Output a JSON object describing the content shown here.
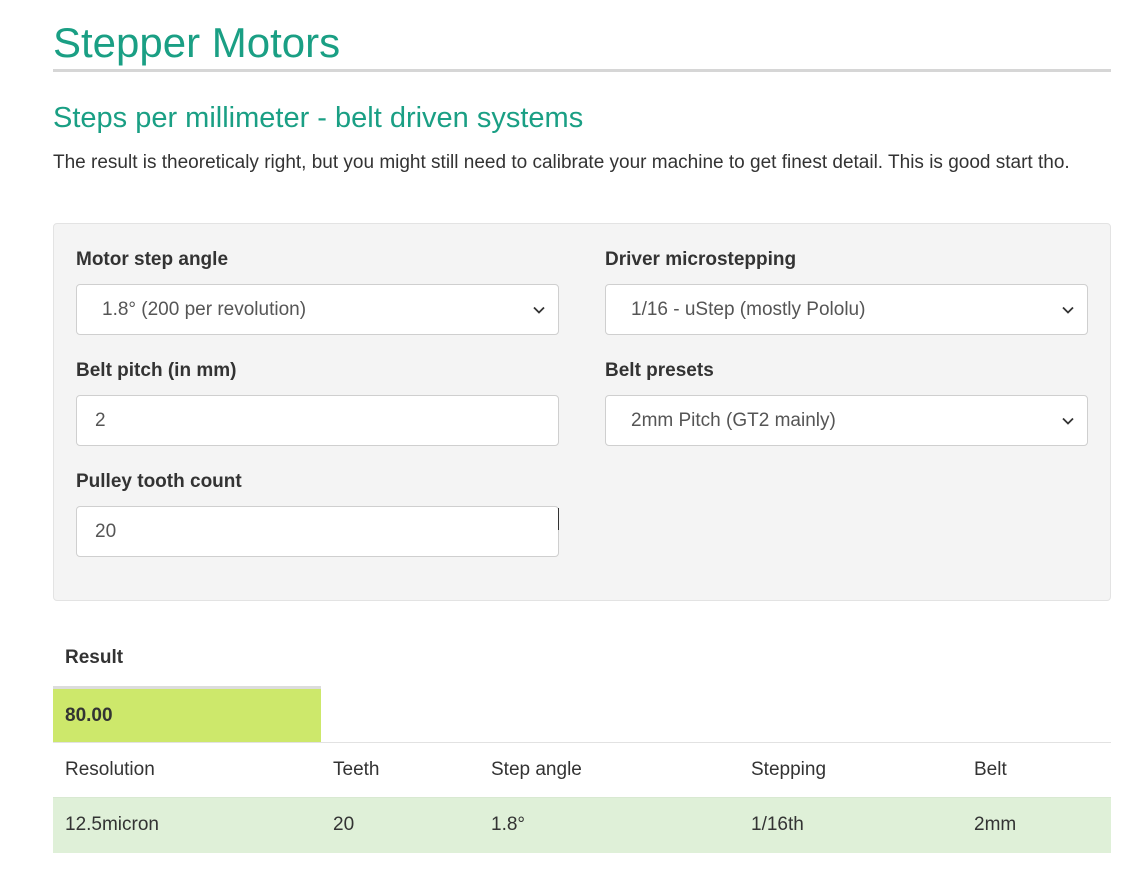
{
  "page": {
    "title": "Stepper Motors",
    "section_title": "Steps per millimeter - belt driven systems",
    "description": "The result is theoreticaly right, but you might still need to calibrate your machine to get finest detail. This is good start tho."
  },
  "form": {
    "motor_step_angle": {
      "label": "Motor step angle",
      "value": "1.8° (200 per revolution)"
    },
    "driver_microstepping": {
      "label": "Driver microstepping",
      "value": "1/16 - uStep (mostly Pololu)"
    },
    "belt_pitch": {
      "label": "Belt pitch (in mm)",
      "value": "2"
    },
    "belt_presets": {
      "label": "Belt presets",
      "value": "2mm Pitch (GT2 mainly)"
    },
    "pulley_tooth_count": {
      "label": "Pulley tooth count",
      "value": "20"
    }
  },
  "result": {
    "label": "Result",
    "value": "80.00",
    "columns": [
      "Resolution",
      "Teeth",
      "Step angle",
      "Stepping",
      "Belt"
    ],
    "row": [
      "12.5micron",
      "20",
      "1.8°",
      "1/16th",
      "2mm"
    ]
  },
  "colors": {
    "accent": "#1a9f84",
    "result_highlight": "#cde86b",
    "success_row": "#dff0d8",
    "panel_bg": "#f4f4f4"
  },
  "icons": {
    "select_indicator": "chevron-down-icon"
  }
}
